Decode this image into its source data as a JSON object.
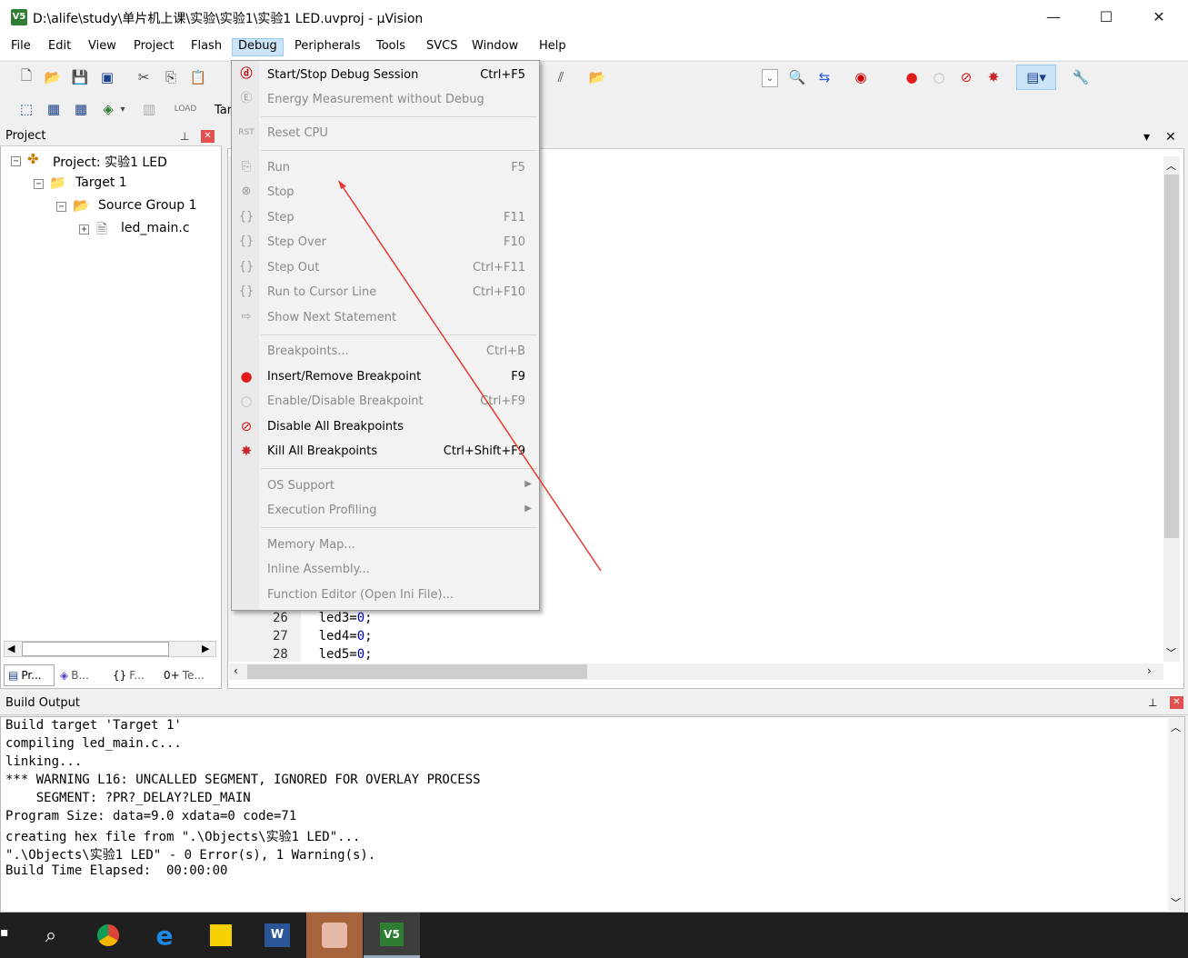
{
  "window": {
    "title": "D:\\alife\\study\\单片机上课\\实验\\实验1\\实验1 LED.uvproj - µVision",
    "app_icon_text": "V5",
    "minimize": "—",
    "maximize": "☐",
    "close": "✕"
  },
  "menubar": {
    "items": [
      "File",
      "Edit",
      "View",
      "Project",
      "Flash",
      "Debug",
      "Peripherals",
      "Tools",
      "SVCS",
      "Window",
      "Help"
    ]
  },
  "toolbar": {
    "target_label": "Tar"
  },
  "project_pane": {
    "title": "Project",
    "pin": "ᵖ",
    "close": "✕",
    "tree": {
      "project": "Project: 实验1 LED",
      "target": "Target 1",
      "group": "Source Group 1",
      "file": "led_main.c"
    },
    "tabs": [
      "Pr...",
      "B...",
      "F...",
      "Te..."
    ],
    "tab_icons": [
      "project-tab-icon",
      "books-icon",
      "{}",
      "0+"
    ]
  },
  "editor": {
    "close": "✕",
    "dropdown": "▾",
    "lines": [
      {
        "n": "26",
        "code": "led3=",
        "val": "0",
        "end": ";"
      },
      {
        "n": "27",
        "code": "led4=",
        "val": "0",
        "end": ";"
      },
      {
        "n": "28",
        "code": "led5=",
        "val": "0",
        "end": ";"
      }
    ]
  },
  "debug_menu": {
    "items": [
      {
        "label": "Start/Stop Debug Session",
        "shortcut": "Ctrl+F5",
        "icon": "debug-session-icon",
        "enabled": true
      },
      {
        "label": "Energy Measurement without Debug",
        "shortcut": "",
        "icon": "energy-icon",
        "enabled": false
      },
      {
        "label": "Reset CPU",
        "shortcut": "",
        "icon": "reset-cpu-icon",
        "enabled": false
      },
      {
        "label": "Run",
        "shortcut": "F5",
        "icon": "run-icon",
        "enabled": false
      },
      {
        "label": "Stop",
        "shortcut": "",
        "icon": "stop-icon",
        "enabled": false
      },
      {
        "label": "Step",
        "shortcut": "F11",
        "icon": "step-icon",
        "enabled": false
      },
      {
        "label": "Step Over",
        "shortcut": "F10",
        "icon": "step-over-icon",
        "enabled": false
      },
      {
        "label": "Step Out",
        "shortcut": "Ctrl+F11",
        "icon": "step-out-icon",
        "enabled": false
      },
      {
        "label": "Run to Cursor Line",
        "shortcut": "Ctrl+F10",
        "icon": "run-to-cursor-icon",
        "enabled": false
      },
      {
        "label": "Show Next Statement",
        "shortcut": "",
        "icon": "next-statement-icon",
        "enabled": false
      },
      {
        "label": "Breakpoints...",
        "shortcut": "Ctrl+B",
        "icon": "",
        "enabled": false
      },
      {
        "label": "Insert/Remove Breakpoint",
        "shortcut": "F9",
        "icon": "breakpoint-icon",
        "enabled": true
      },
      {
        "label": "Enable/Disable Breakpoint",
        "shortcut": "Ctrl+F9",
        "icon": "enable-breakpoint-icon",
        "enabled": false
      },
      {
        "label": "Disable All Breakpoints",
        "shortcut": "",
        "icon": "disable-breakpoints-icon",
        "enabled": true
      },
      {
        "label": "Kill All Breakpoints",
        "shortcut": "Ctrl+Shift+F9",
        "icon": "kill-breakpoints-icon",
        "enabled": true
      },
      {
        "label": "OS Support",
        "shortcut": "▶",
        "icon": "",
        "enabled": false
      },
      {
        "label": "Execution Profiling",
        "shortcut": "▶",
        "icon": "",
        "enabled": false
      },
      {
        "label": "Memory Map...",
        "shortcut": "",
        "icon": "",
        "enabled": false
      },
      {
        "label": "Inline Assembly...",
        "shortcut": "",
        "icon": "",
        "enabled": false
      },
      {
        "label": "Function Editor (Open Ini File)...",
        "shortcut": "",
        "icon": "",
        "enabled": false
      }
    ]
  },
  "build_output": {
    "title": "Build Output",
    "lines": [
      "Build target 'Target 1'",
      "compiling led_main.c...",
      "linking...",
      "*** WARNING L16: UNCALLED SEGMENT, IGNORED FOR OVERLAY PROCESS",
      "    SEGMENT: ?PR?_DELAY?LED_MAIN",
      "Program Size: data=9.0 xdata=0 code=71",
      "creating hex file from \".\\Objects\\实验1 LED\"...",
      "\".\\Objects\\实验1 LED\" - 0 Error(s), 1 Warning(s).",
      "Build Time Elapsed:  00:00:00"
    ]
  },
  "colors": {
    "annotation_arrow": "#e53935",
    "menu_highlight": "#cce4f7",
    "code_number": "#0000bb"
  }
}
